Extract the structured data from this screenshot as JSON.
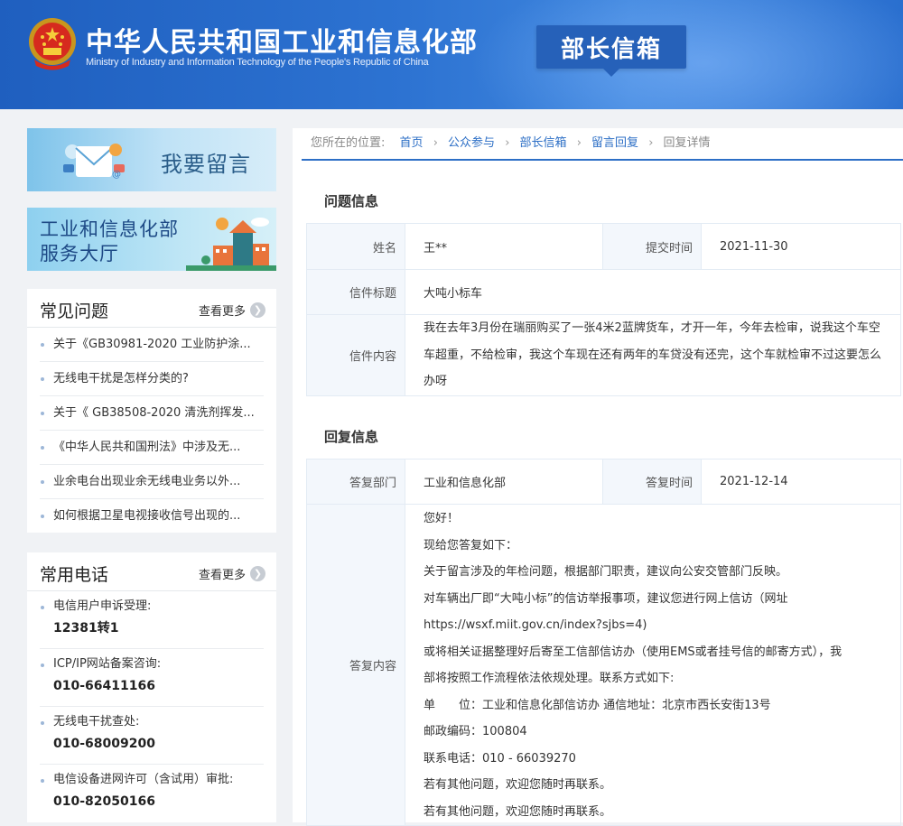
{
  "header": {
    "site_title": "中华人民共和国工业和信息化部",
    "site_subtitle": "Ministry of Industry and Information Technology of the People's Republic of China",
    "section_badge": "部长信箱",
    "colors": {
      "primary": "#2d6fc6",
      "header_bg": "#2a6cc9"
    }
  },
  "sidebar": {
    "leave_message_label": "我要留言",
    "service_hall_line1": "工业和信息化部",
    "service_hall_line2": "服务大厅",
    "faq": {
      "title": "常见问题",
      "more": "查看更多",
      "items": [
        "关于《GB30981-2020 工业防护涂...",
        "无线电干扰是怎样分类的?",
        "关于《 GB38508-2020 清洗剂挥发...",
        "《中华人民共和国刑法》中涉及无...",
        "业余电台出现业余无线电业务以外...",
        "如何根据卫星电视接收信号出现的..."
      ]
    },
    "phones": {
      "title": "常用电话",
      "more": "查看更多",
      "items": [
        {
          "label": "电信用户申诉受理:",
          "number": "12381转1"
        },
        {
          "label": "ICP/IP网站备案咨询:",
          "number": "010-66411166"
        },
        {
          "label": "无线电干扰查处:",
          "number": "010-68009200"
        },
        {
          "label": "电信设备进网许可（含试用）审批:",
          "number": "010-82050166"
        }
      ]
    }
  },
  "breadcrumb": {
    "prefix": "您所在的位置:",
    "links": [
      "首页",
      "公众参与",
      "部长信箱",
      "留言回复"
    ],
    "current": "回复详情"
  },
  "question": {
    "section_title": "问题信息",
    "name_label": "姓名",
    "name_value": "王**",
    "time_label": "提交时间",
    "time_value": "2021-11-30",
    "subject_label": "信件标题",
    "subject_value": "大吨小标车",
    "content_label": "信件内容",
    "content_value": "我在去年3月份在瑞丽购买了一张4米2蓝牌货车，才开一年，今年去检审，说我这个车空车超重，不给检审，我这个车现在还有两年的车贷没有还完，这个车就检审不过这要怎么办呀"
  },
  "reply": {
    "section_title": "回复信息",
    "dept_label": "答复部门",
    "dept_value": "工业和信息化部",
    "time_label": "答复时间",
    "time_value": "2021-12-14",
    "content_label": "答复内容",
    "lines": [
      "您好！",
      "现给您答复如下：",
      "关于留言涉及的年检问题，根据部门职责，建议向公安交管部门反映。",
      "对车辆出厂即“大吨小标”的信访举报事项，建议您进行网上信访（网址",
      "https://wsxf.miit.gov.cn/index?sjbs=4)",
      "或将相关证据整理好后寄至工信部信访办（使用EMS或者挂号信的邮寄方式），我",
      "部将按照工作流程依法依规处理。联系方式如下:",
      "单　　位：工业和信息化部信访办 通信地址：北京市西长安街13号",
      "邮政编码：100804",
      "联系电话：010 - 66039270",
      "若有其他问题，欢迎您随时再联系。",
      "若有其他问题，欢迎您随时再联系。"
    ]
  }
}
